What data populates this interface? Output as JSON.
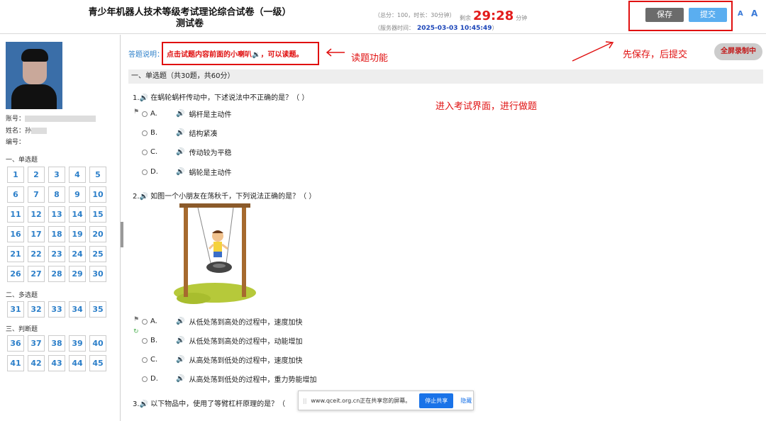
{
  "header": {
    "title_line1": "青少年机器人技术等级考试理论综合试卷（一级）",
    "title_line2": "测试卷",
    "score_info": "（总分：100，时长：30分钟）",
    "remain_label": "剩余",
    "remain_time": "29:28",
    "remain_unit": "分钟",
    "server_time_label": "（服务器时间：",
    "server_time": "2025-03-03 10:45:49",
    "server_time_end": "）",
    "save_label": "保存",
    "submit_label": "提交",
    "font_icon_glyph": "A"
  },
  "candidate": {
    "account_label": "账号：",
    "name_label": "姓名：",
    "name_visible": "孙",
    "id_label": "编号："
  },
  "sidebar": {
    "section1_label": "一、单选题",
    "section2_label": "二、多选题",
    "section3_label": "三、判断题",
    "single_choice": [
      "1",
      "2",
      "3",
      "4",
      "5",
      "6",
      "7",
      "8",
      "9",
      "10",
      "11",
      "12",
      "13",
      "14",
      "15",
      "16",
      "17",
      "18",
      "19",
      "20",
      "21",
      "22",
      "23",
      "24",
      "25",
      "26",
      "27",
      "28",
      "29",
      "30"
    ],
    "multi_choice": [
      "31",
      "32",
      "33",
      "34",
      "35"
    ],
    "judge": [
      "36",
      "37",
      "38",
      "39",
      "40",
      "41",
      "42",
      "43",
      "44",
      "45"
    ]
  },
  "instructions": {
    "label": "答题说明：",
    "text": "点击试题内容前面的小喇叭",
    "text_end": "，可以读题。"
  },
  "annotations": {
    "read_feature": "读题功能",
    "save_then_submit": "先保存，后提交",
    "enter_exam": "进入考试界面，进行做题"
  },
  "fullscreen_label": "全屏录制中",
  "section_header": "一、单选题（共30题，共60分）",
  "questions": [
    {
      "number": "1.",
      "text": "在蜗轮蜗杆传动中，下述说法中不正确的是？（    ）",
      "options": [
        {
          "label": "A.",
          "text": "蜗杆是主动件"
        },
        {
          "label": "B.",
          "text": "结构紧凑"
        },
        {
          "label": "C.",
          "text": "传动较为平稳"
        },
        {
          "label": "D.",
          "text": "蜗轮是主动件"
        }
      ]
    },
    {
      "number": "2.",
      "text": "如图一个小朋友在荡秋千，下列说法正确的是？（    ）",
      "options": [
        {
          "label": "A.",
          "text": "从低处荡到高处的过程中，速度加快"
        },
        {
          "label": "B.",
          "text": "从低处荡到高处的过程中，动能增加"
        },
        {
          "label": "C.",
          "text": "从高处荡到低处的过程中，速度加快"
        },
        {
          "label": "D.",
          "text": "从高处荡到低处的过程中，重力势能增加"
        }
      ]
    },
    {
      "number": "3.",
      "text": "以下物品中，使用了等臂杠杆原理的是？（"
    }
  ],
  "share_bar": {
    "grip": "||",
    "text": "www.qceit.org.cn正在共享您的屏幕。",
    "stop_label": "停止共享",
    "hide_label": "隐藏"
  },
  "colors": {
    "accent_blue": "#2c7fc9",
    "timer_red": "#e21b1b",
    "annotation_red": "#e01010",
    "save_gray": "#6b6b6b",
    "submit_blue": "#5aaef0"
  }
}
